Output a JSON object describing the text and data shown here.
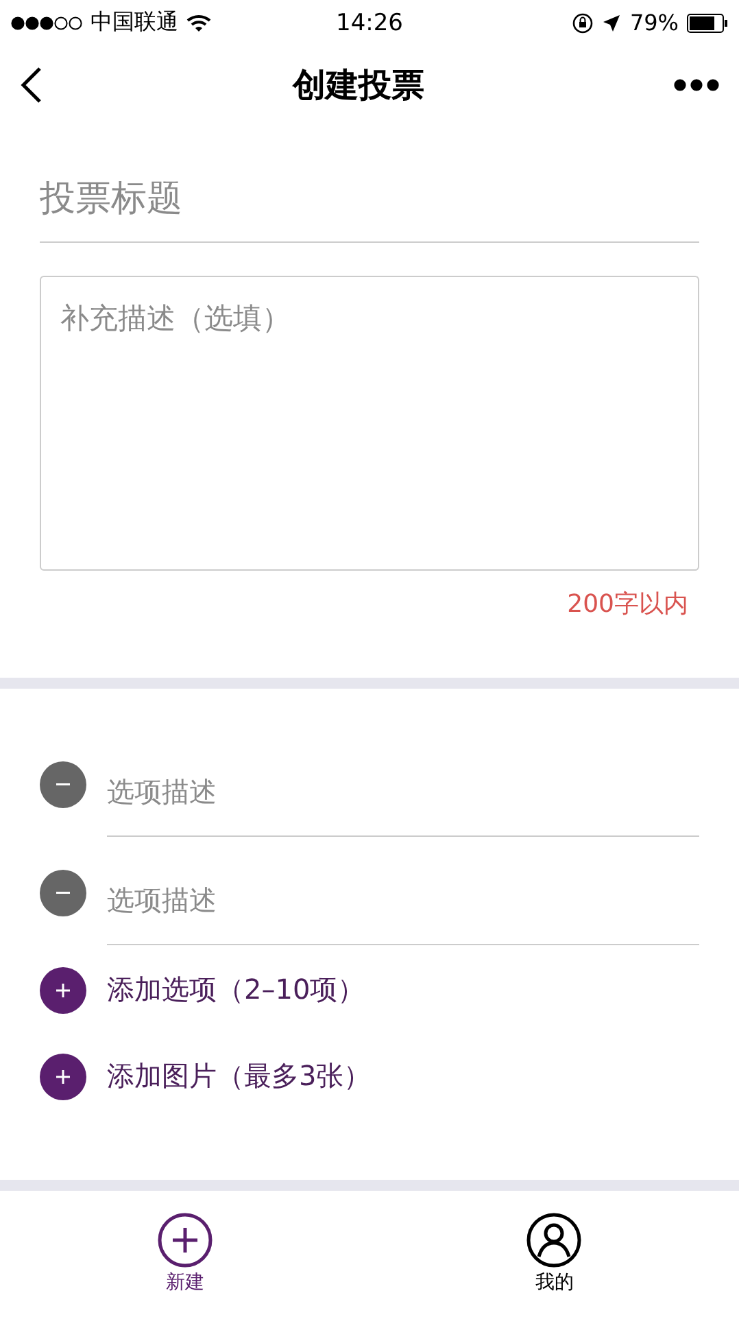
{
  "status_bar": {
    "carrier": "中国联通",
    "time": "14:26",
    "battery": "79%"
  },
  "nav": {
    "title": "创建投票"
  },
  "form": {
    "title_placeholder": "投票标题",
    "description_placeholder": "补充描述（选填）",
    "limit": "200字以内"
  },
  "options": [
    {
      "kind": "option",
      "placeholder": "选项描述"
    },
    {
      "kind": "option",
      "placeholder": "选项描述"
    },
    {
      "kind": "add",
      "label": "添加选项（2–10项）"
    },
    {
      "kind": "add",
      "label": "添加图片（最多3张）"
    }
  ],
  "tab_bar": [
    {
      "kind": "new",
      "label": "新建",
      "selected": true
    },
    {
      "kind": "me",
      "label": "我的",
      "selected": false
    }
  ]
}
